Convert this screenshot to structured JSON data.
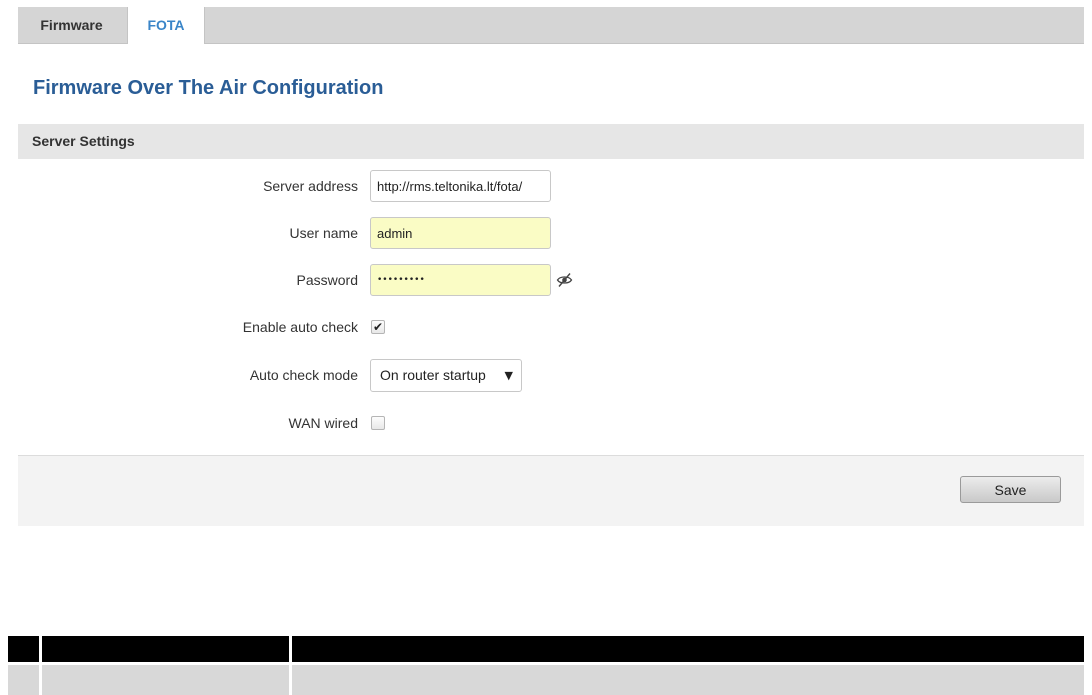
{
  "tabs": [
    {
      "label": "Firmware",
      "active": false
    },
    {
      "label": "FOTA",
      "active": true
    }
  ],
  "page_title": "Firmware Over The Air Configuration",
  "section": {
    "title": "Server Settings"
  },
  "form": {
    "server_address": {
      "label": "Server address",
      "value": "http://rms.teltonika.lt/fota/"
    },
    "user_name": {
      "label": "User name",
      "value": "admin"
    },
    "password": {
      "label": "Password",
      "value": "•••••••••",
      "reveal_icon": "eye-slash-icon"
    },
    "enable_auto_check": {
      "label": "Enable auto check",
      "checked": true
    },
    "auto_check_mode": {
      "label": "Auto check mode",
      "selected": "On router startup",
      "dropdown_icon": "▼"
    },
    "wan_wired": {
      "label": "WAN wired",
      "checked": false
    }
  },
  "footer": {
    "save_label": "Save"
  },
  "colors": {
    "accent_tab": "#3a85c8",
    "title": "#2a5d96",
    "autofill_bg": "#fafcc5",
    "header_bg": "#e6e6e6"
  }
}
